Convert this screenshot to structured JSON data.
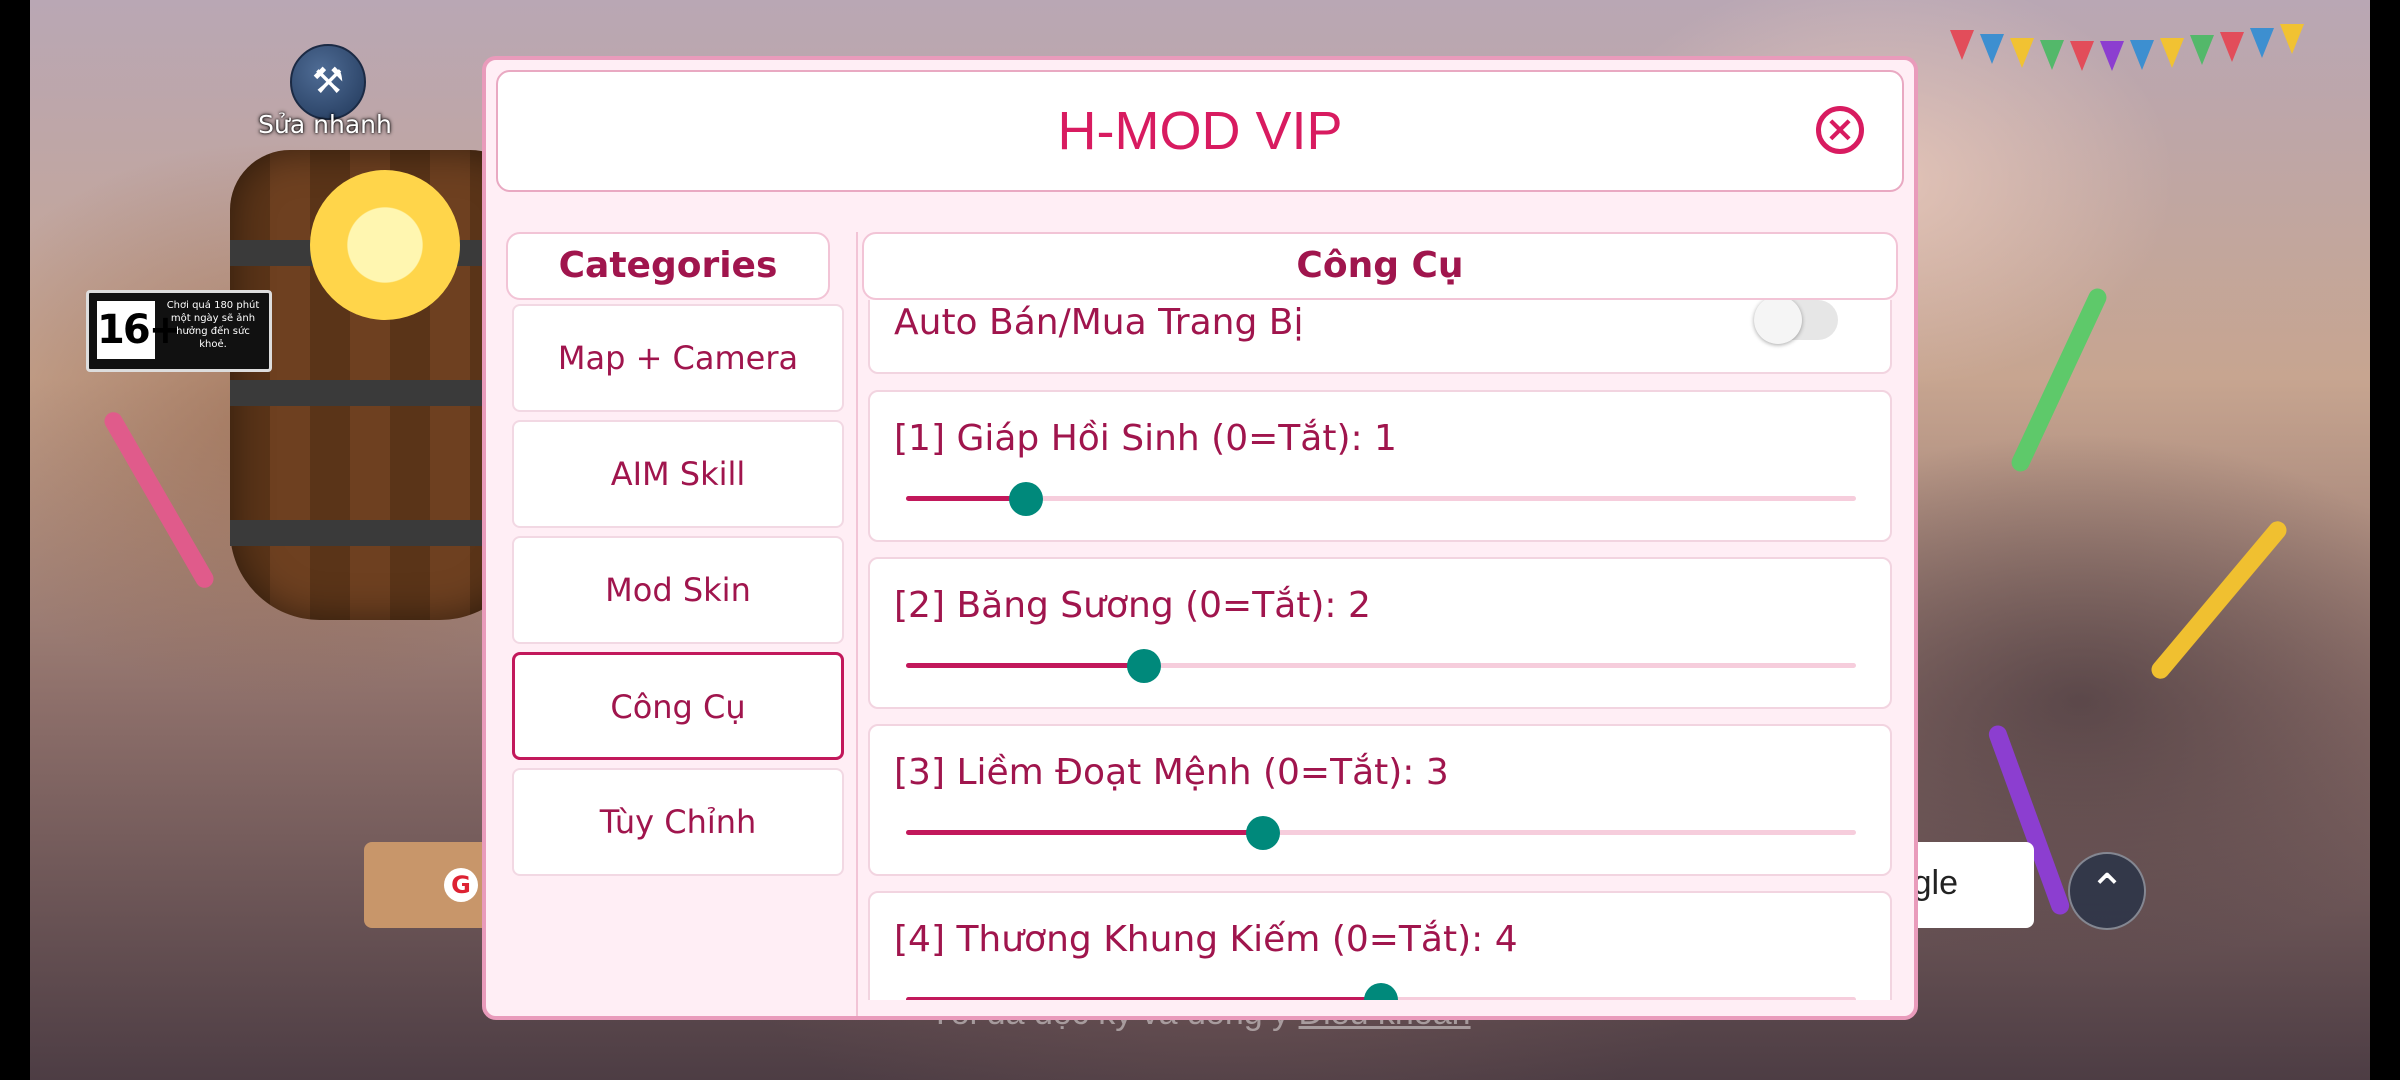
{
  "background": {
    "quick_fix_label": "Sửa nhanh",
    "age_rating": "16+",
    "age_note": "Chơi quá 180 phút một ngày sẽ ảnh hưởng đến sức khoẻ.",
    "login_right_text": "gle",
    "terms_prefix": "Tôi đã đọc kỹ và đồng ý ",
    "terms_link": "Điều khoản"
  },
  "dialog": {
    "title": "H-MOD VIP",
    "categories_header": "Categories",
    "categories": [
      "Map + Camera",
      "AIM Skill",
      "Mod Skin",
      "Công Cụ",
      "Tùy Chỉnh"
    ],
    "active_category": "Công Cụ",
    "section_header": "Công Cụ",
    "toggle": {
      "label": "Auto Bán/Mua Trang Bị",
      "on": false
    },
    "sliders": [
      {
        "label": "[1] Giáp Hồi Sinh (0=Tắt): 1",
        "value": 1,
        "fraction": 0.126
      },
      {
        "label": "[2] Băng Sương (0=Tắt): 2",
        "value": 2,
        "fraction": 0.25
      },
      {
        "label": "[3] Liềm Đoạt Mệnh (0=Tắt): 3",
        "value": 3,
        "fraction": 0.376
      },
      {
        "label": "[4] Thương Khung Kiếm (0=Tắt): 4",
        "value": 4,
        "fraction": 0.5
      }
    ]
  },
  "colors": {
    "accent": "#d81b60",
    "label": "#a0154d",
    "slider_thumb": "#00897b",
    "panel_bg": "#ffeef5"
  }
}
